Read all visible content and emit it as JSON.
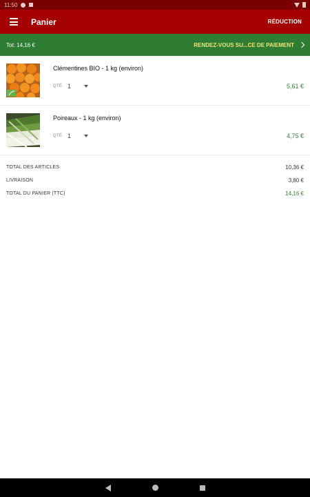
{
  "status_bar": {
    "time": "11:50"
  },
  "app_bar": {
    "title": "Panier",
    "discount_label": "RÉDUCTION",
    "menu_icon": "menu-icon"
  },
  "checkout_bar": {
    "total_short": "Tot: 14,16 €",
    "checkout_label": "RENDEZ-VOUS SU...CE DE PAIEMENT",
    "chevron_icon": "chevron-right-icon"
  },
  "items": [
    {
      "name": "Clémentines BIO - 1 kg (environ)",
      "qty_label": "QTÉ",
      "qty": "1",
      "price": "5,61 €",
      "organic_badge": true
    },
    {
      "name": "Poireaux - 1 kg (environ)",
      "qty_label": "QTÉ",
      "qty": "1",
      "price": "4,75 €",
      "organic_badge": false
    }
  ],
  "totals": {
    "articles_label": "TOTAL DES ARTICLES",
    "articles_value": "10,36 €",
    "delivery_label": "LIVRAISON",
    "delivery_value": "3,80 €",
    "cart_label": "TOTAL DU PANIER (TTC)",
    "cart_value": "14,16 €"
  },
  "colors": {
    "app_bar": "#a50000",
    "status_bar": "#7a0000",
    "checkout_bar": "#2e7d32",
    "checkout_text": "#f1e27a",
    "price": "#2e7d32"
  }
}
